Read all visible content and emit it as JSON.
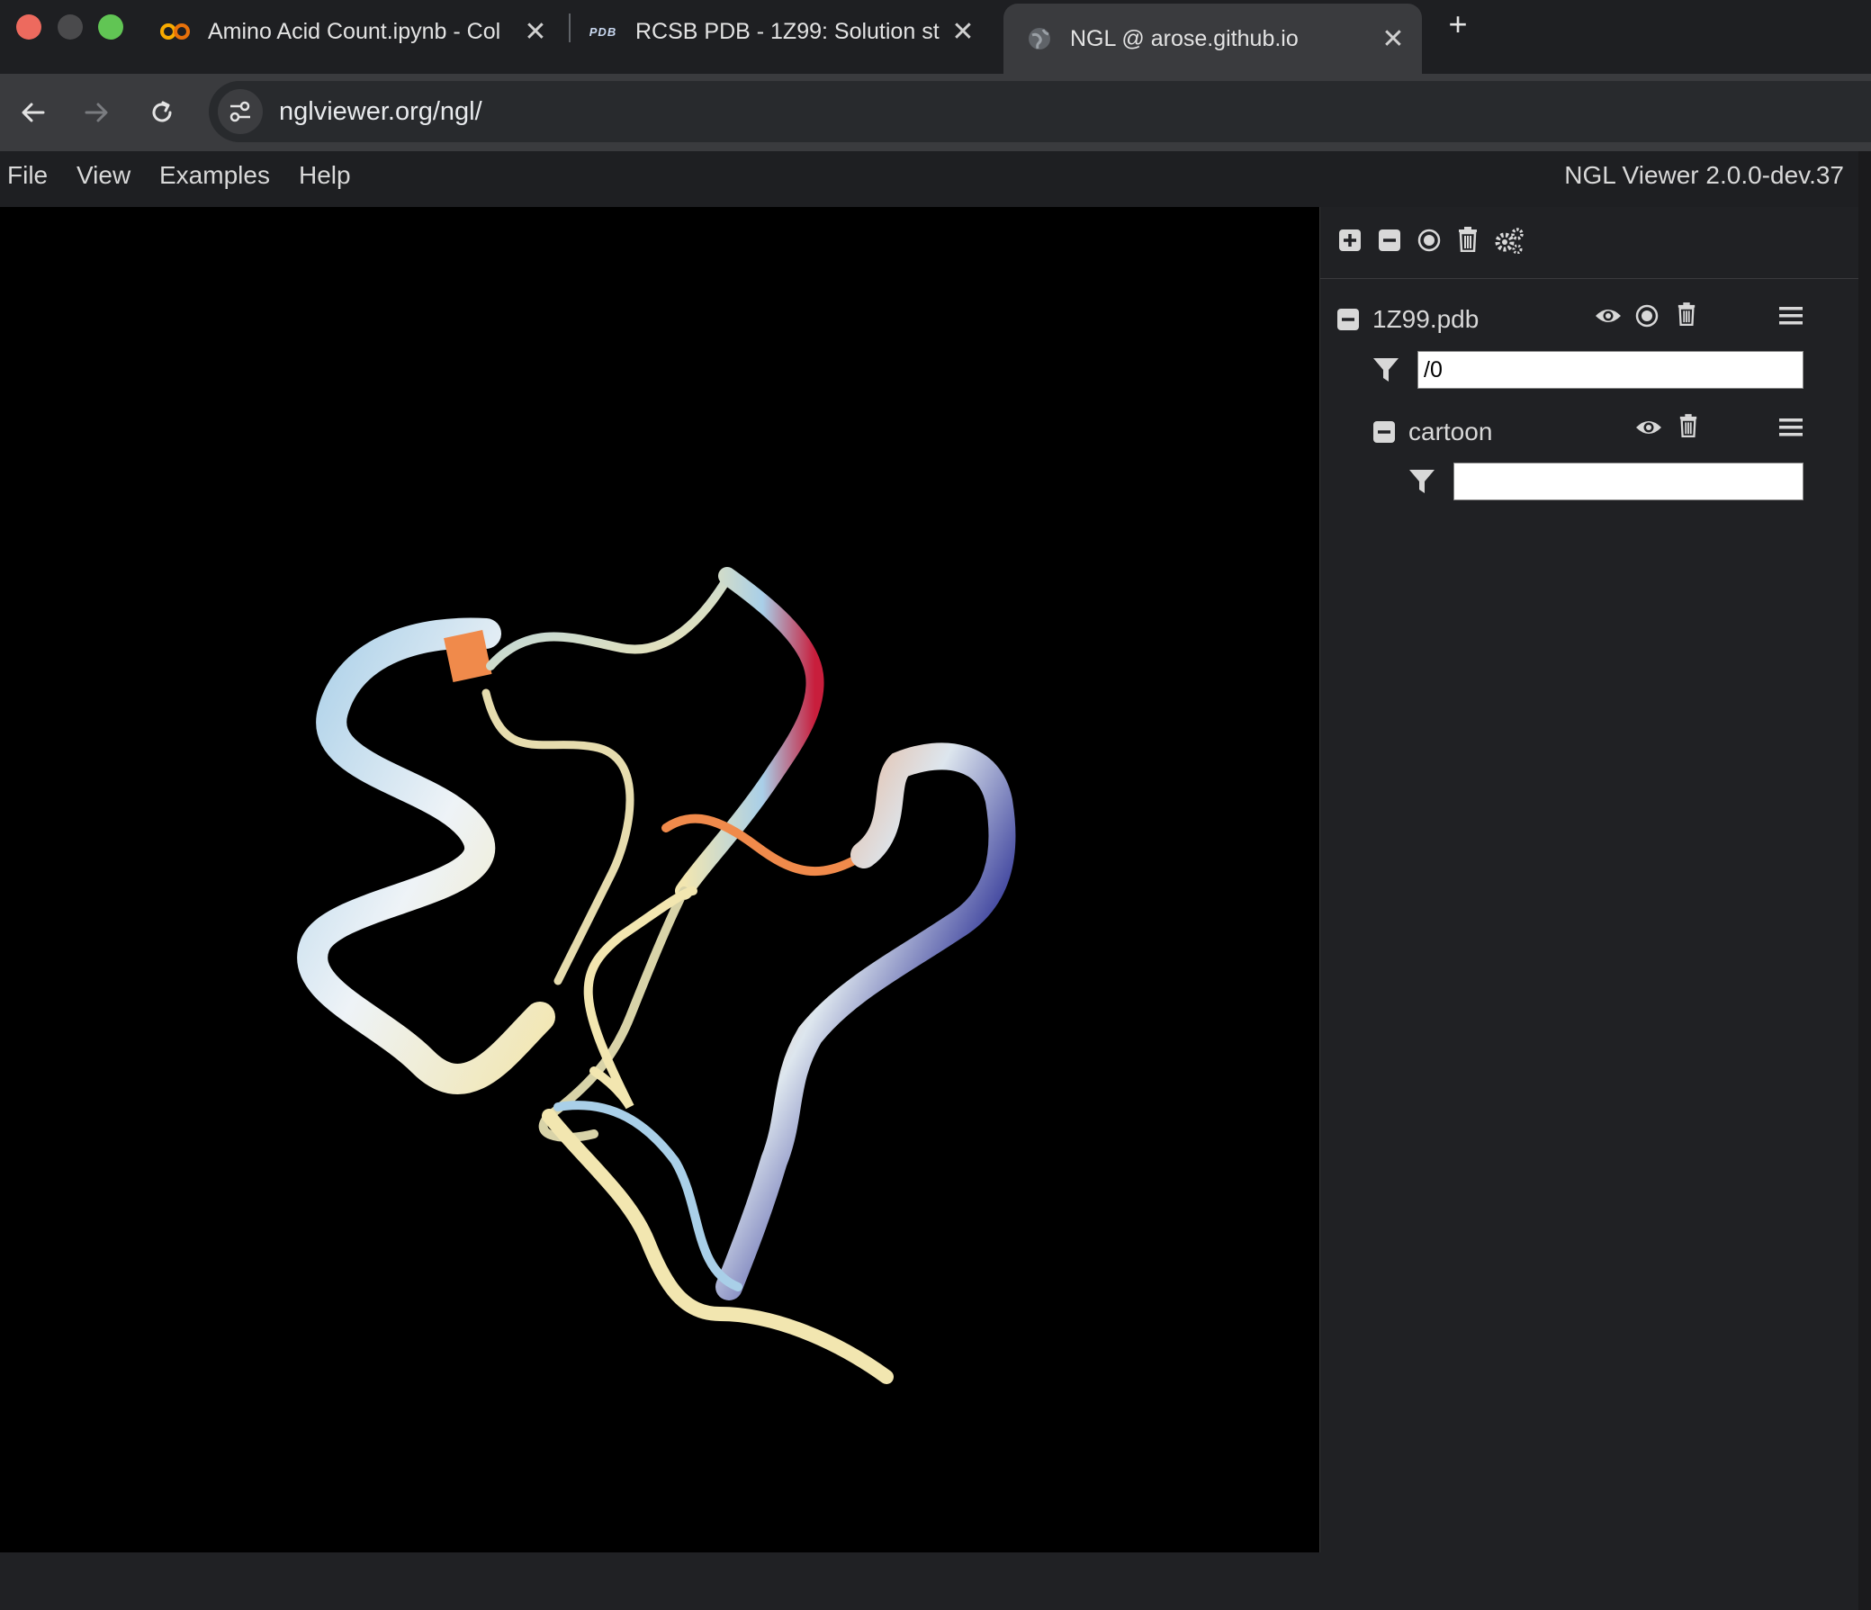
{
  "browser": {
    "tabs": [
      {
        "title": "Amino Acid Count.ipynb - Col",
        "favicon": "colab-icon"
      },
      {
        "title": "RCSB PDB - 1Z99: Solution st",
        "favicon": "pdb-icon",
        "favicon_text": "PDB"
      },
      {
        "title": "NGL @ arose.github.io",
        "favicon": "globe-icon",
        "active": true
      }
    ],
    "close_glyph": "✕",
    "new_tab_glyph": "+",
    "url": "nglviewer.org/ngl/"
  },
  "app": {
    "menu": [
      "File",
      "View",
      "Examples",
      "Help"
    ],
    "version": "NGL Viewer 2.0.0-dev.37",
    "components": [
      {
        "name": "1Z99.pdb",
        "filter_value": "/0",
        "representations": [
          {
            "name": "cartoon",
            "filter_value": ""
          }
        ]
      }
    ]
  },
  "colors": {
    "viewport_bg": "#000000",
    "panel_bg": "#202124",
    "ribbon_light_blue": "#a9cfe8",
    "ribbon_cream": "#f2e6b0",
    "ribbon_orange": "#f08a4b",
    "ribbon_red": "#c81e3c",
    "ribbon_navy": "#1b1f8c"
  }
}
